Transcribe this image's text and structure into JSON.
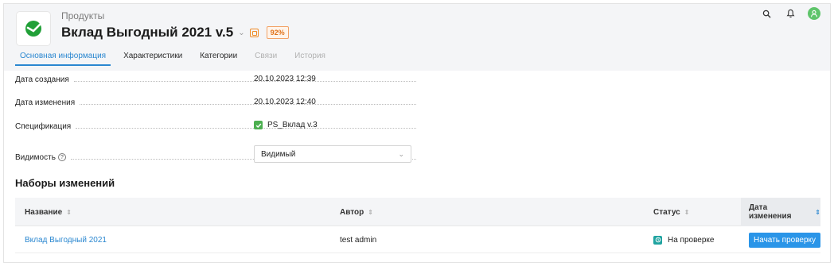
{
  "header": {
    "breadcrumb": "Продукты",
    "title": "Вклад Выгодный 2021 v.5",
    "completeness": "92%",
    "logo_icon": "sber-logo-icon",
    "icons": [
      "search-icon",
      "bell-icon",
      "user-avatar-icon"
    ],
    "accent": "#2a87d0"
  },
  "tabs": [
    {
      "label": "Основная информация",
      "state": "active"
    },
    {
      "label": "Характеристики",
      "state": "normal"
    },
    {
      "label": "Категории",
      "state": "normal"
    },
    {
      "label": "Связи",
      "state": "disabled"
    },
    {
      "label": "История",
      "state": "disabled"
    }
  ],
  "info": {
    "created_label": "Дата создания",
    "created_value": "20.10.2023 12:39",
    "modified_label": "Дата изменения",
    "modified_value": "20.10.2023 12:40",
    "spec_label": "Спецификация",
    "spec_value": "PS_Вклад v.3",
    "visibility_label": "Видимость",
    "visibility_value": "Видимый"
  },
  "changesets": {
    "title": "Наборы изменений",
    "columns": [
      "Название",
      "Автор",
      "Статус",
      "Дата изменения"
    ],
    "rows": [
      {
        "name": "Вклад Выгодный 2021",
        "author": "test admin",
        "status": "На проверке",
        "action": "Начать проверку"
      }
    ]
  }
}
